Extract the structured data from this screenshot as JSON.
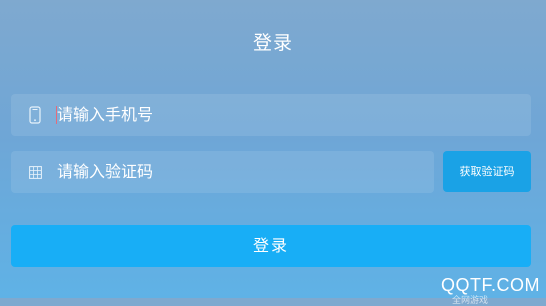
{
  "header": {
    "title": "登录"
  },
  "form": {
    "phone": {
      "icon": "mobile-phone-icon",
      "placeholder": "请输入手机号"
    },
    "code": {
      "icon": "grid-code-icon",
      "placeholder": "请输入验证码",
      "button_label": "获取验证码"
    },
    "submit_label": "登录"
  },
  "watermark": {
    "text": "QQTF.COM",
    "sub": "全网游戏"
  },
  "colors": {
    "button_accent": "#18aef6",
    "code_button": "#1aa2e6",
    "caret": "#e36c7c"
  }
}
